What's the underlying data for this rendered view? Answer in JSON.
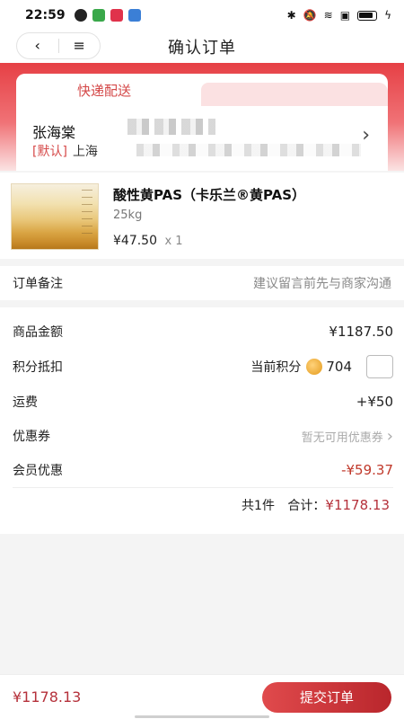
{
  "status_bar": {
    "time": "22:59"
  },
  "header": {
    "back_icon": "‹",
    "menu_icon": "≡",
    "title": "确认订单"
  },
  "delivery": {
    "tab_label": "快递配送"
  },
  "address": {
    "name": "张海棠",
    "default_tag": "[默认]",
    "city": "上海",
    "chevron": "›"
  },
  "product": {
    "name": "酸性黄PAS（卡乐兰®黄PAS）",
    "spec": "25kg",
    "price": "¥47.50",
    "qty": "x 1"
  },
  "remark": {
    "label": "订单备注",
    "placeholder": "建议留言前先与商家沟通"
  },
  "summary": {
    "goods_amount_label": "商品金额",
    "goods_amount": "¥1187.50",
    "points_label": "积分抵扣",
    "points_current_label": "当前积分",
    "points_value": "704",
    "shipping_label": "运费",
    "shipping_value": "+¥50",
    "coupon_label": "优惠券",
    "coupon_value": "暂无可用优惠券",
    "coupon_chevron": "›",
    "member_label": "会员优惠",
    "member_value": "-¥59.37",
    "count_text": "共1件",
    "total_label": "合计：",
    "total_value": "¥1178.13"
  },
  "bottom": {
    "pay_amount": "¥1178.13",
    "submit_label": "提交订单"
  },
  "colors": {
    "brand_red": "#b5313b",
    "band_red": "#e64045"
  }
}
